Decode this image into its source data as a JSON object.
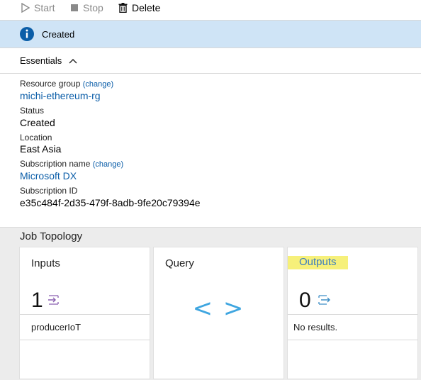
{
  "toolbar": {
    "start_label": "Start",
    "stop_label": "Stop",
    "delete_label": "Delete"
  },
  "status": {
    "text": "Created",
    "icon": "info-icon"
  },
  "essentials": {
    "header": "Essentials",
    "resource_group_label": "Resource group",
    "resource_group_change": "(change)",
    "resource_group_value": "michi-ethereum-rg",
    "status_label": "Status",
    "status_value": "Created",
    "location_label": "Location",
    "location_value": "East Asia",
    "subscription_name_label": "Subscription name",
    "subscription_name_change": "(change)",
    "subscription_name_value": "Microsoft DX",
    "subscription_id_label": "Subscription ID",
    "subscription_id_value": "e35c484f-2d35-479f-8adb-9fe20c79394e"
  },
  "topology": {
    "title": "Job Topology",
    "inputs": {
      "title": "Inputs",
      "count": "1",
      "item": "producerIoT"
    },
    "query": {
      "title": "Query",
      "glyph": "< >"
    },
    "outputs": {
      "title": "Outputs",
      "count": "0",
      "item": "No results."
    }
  },
  "colors": {
    "status_bg": "#cfe4f6",
    "link": "#0a5da8",
    "query_icon": "#3fa6e0",
    "highlight": "#f6f07a"
  }
}
